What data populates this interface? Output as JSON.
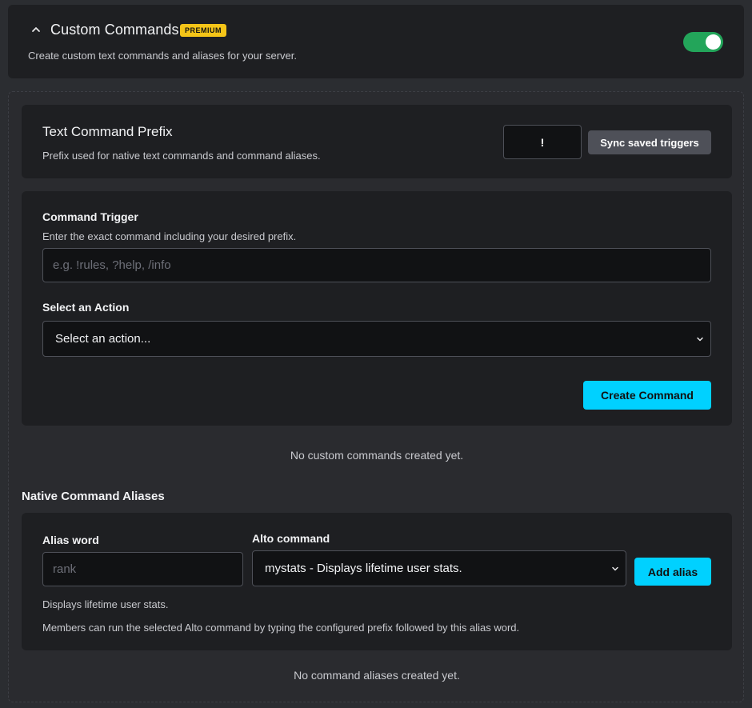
{
  "header": {
    "title": "Custom Commands",
    "badge": "PREMIUM",
    "description": "Create custom text commands and aliases for your server.",
    "enabled": true,
    "toggle_color": "#23a55a"
  },
  "prefix": {
    "title": "Text Command Prefix",
    "description": "Prefix used for native text commands and command aliases.",
    "value": "!",
    "sync_label": "Sync saved triggers"
  },
  "command": {
    "trigger_label": "Command Trigger",
    "trigger_hint": "Enter the exact command including your desired prefix.",
    "trigger_placeholder": "e.g. !rules, ?help, /info",
    "trigger_value": "",
    "action_label": "Select an Action",
    "action_selected": "Select an action...",
    "create_label": "Create Command",
    "empty_text": "No custom commands created yet."
  },
  "aliases": {
    "section_title": "Native Command Aliases",
    "alias_label": "Alias word",
    "alias_placeholder": "rank",
    "alias_value": "",
    "command_label": "Alto command",
    "command_selected": "mystats - Displays lifetime user stats.",
    "add_label": "Add alias",
    "command_description": "Displays lifetime user stats.",
    "help_text": "Members can run the selected Alto command by typing the configured prefix followed by this alias word.",
    "empty_text": "No command aliases created yet."
  },
  "colors": {
    "accent": "#00d1ff",
    "premium": "#f5c518",
    "background": "#2b2d31",
    "card": "#1e1f22"
  },
  "icons": {
    "collapse": "chevron-up-icon",
    "dropdown": "chevron-down-icon"
  }
}
